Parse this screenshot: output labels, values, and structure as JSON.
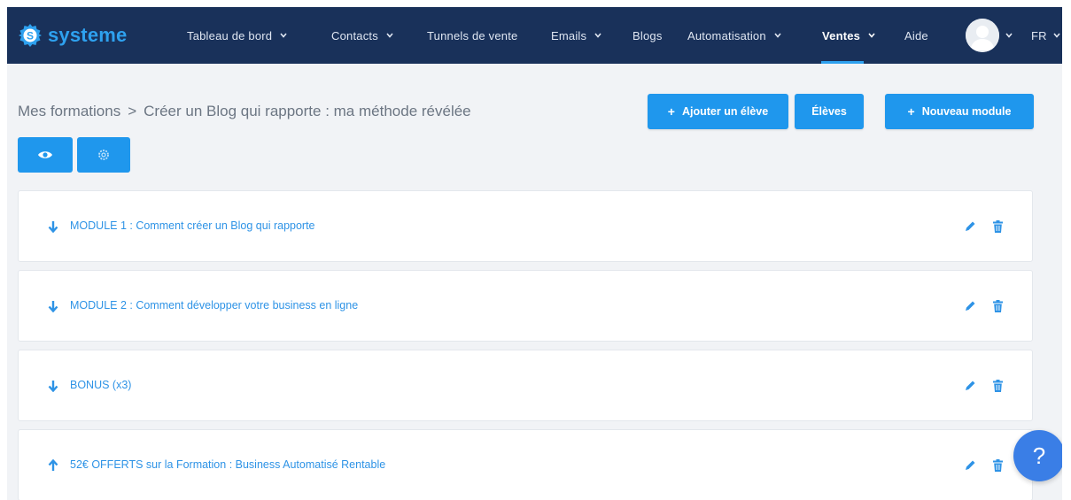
{
  "brand": {
    "name": "systeme",
    "accent": "#2ea1ef",
    "nav_bg": "#19315a",
    "button": "#1f97ed"
  },
  "nav": {
    "items": [
      {
        "label": "Tableau de bord",
        "dropdown": true
      },
      {
        "label": "Contacts",
        "dropdown": true
      },
      {
        "label": "Tunnels de vente",
        "dropdown": false
      },
      {
        "label": "Emails",
        "dropdown": true
      },
      {
        "label": "Blogs",
        "dropdown": false
      },
      {
        "label": "Automatisation",
        "dropdown": true
      },
      {
        "label": "Ventes",
        "dropdown": true,
        "active": true
      },
      {
        "label": "Aide",
        "dropdown": false
      }
    ],
    "language": "FR"
  },
  "breadcrumb": {
    "root": "Mes formations",
    "separator": ">",
    "current": "Créer un Blog qui rapporte : ma méthode révélée"
  },
  "actions": {
    "add_student": "Ajouter un élève",
    "students": "Élèves",
    "new_module": "Nouveau module",
    "plus": "+"
  },
  "modules": [
    {
      "title": "MODULE 1 : Comment créer un Blog qui rapporte",
      "arrow": "down"
    },
    {
      "title": "MODULE 2 : Comment développer votre business en ligne",
      "arrow": "down"
    },
    {
      "title": "BONUS (x3)",
      "arrow": "down"
    },
    {
      "title": "52€ OFFERTS sur la Formation : Business Automatisé Rentable",
      "arrow": "up"
    }
  ],
  "help": {
    "label": "?"
  }
}
